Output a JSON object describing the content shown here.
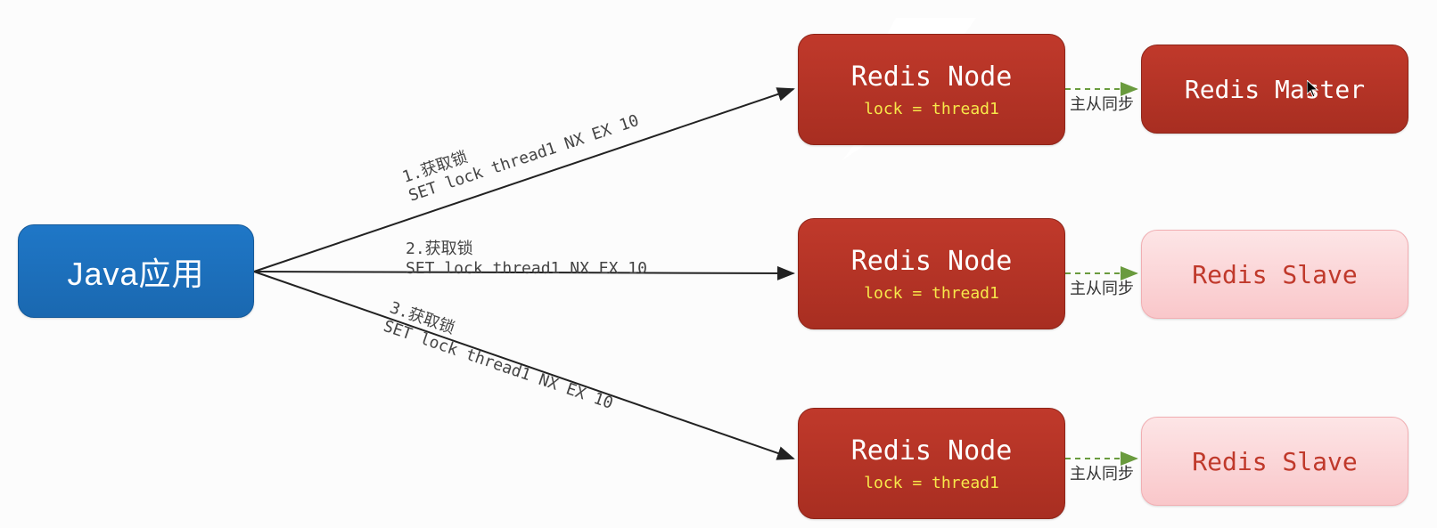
{
  "nodes": {
    "java": {
      "label": "Java应用"
    },
    "redis_node_1": {
      "title": "Redis Node",
      "sub": "lock = thread1"
    },
    "redis_node_2": {
      "title": "Redis Node",
      "sub": "lock = thread1"
    },
    "redis_node_3": {
      "title": "Redis Node",
      "sub": "lock = thread1"
    },
    "redis_master": {
      "title": "Redis Master"
    },
    "redis_slave_1": {
      "title": "Redis Slave"
    },
    "redis_slave_2": {
      "title": "Redis Slave"
    }
  },
  "edges": {
    "e1": {
      "label": "1.获取锁\nSET lock thread1 NX EX 10"
    },
    "e2": {
      "label": "2.获取锁\nSET lock thread1 NX EX 10"
    },
    "e3": {
      "label": "3.获取锁\nSET lock thread1 NX EX 10"
    }
  },
  "sync": {
    "s1": "主从同步",
    "s2": "主从同步",
    "s3": "主从同步"
  },
  "colors": {
    "java_bg": "#1f77c7",
    "redis_bg": "#c0392b",
    "slave_bg": "#fcd5d7",
    "lock_text": "#f7e84a"
  }
}
